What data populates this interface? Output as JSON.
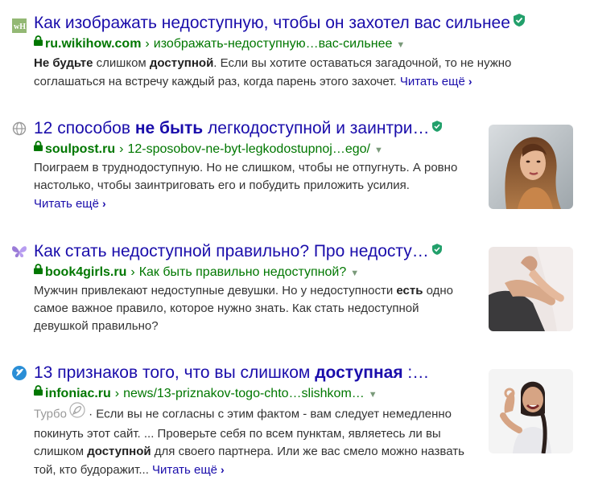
{
  "results": [
    {
      "favicon": "wikihow-logo-icon",
      "favicon_text": "wH",
      "title_parts": [
        {
          "text": "Как изображать недоступную, чтобы он захотел вас сильнее",
          "bold": false
        }
      ],
      "verified": true,
      "domain": "ru.wikihow.com",
      "path": "изображать-недоступную…вас-сильнее",
      "snippet_parts": [
        {
          "text": "Не будьте",
          "bold": true
        },
        {
          "text": " слишком ",
          "bold": false
        },
        {
          "text": "доступной",
          "bold": true
        },
        {
          "text": ". Если вы хотите оставаться загадочной, то не нужно соглашаться на встречу каждый раз, когда парень этого захочет.",
          "bold": false
        }
      ],
      "read_more": "Читать ещё"
    },
    {
      "favicon": "globe-icon",
      "title_parts": [
        {
          "text": "12 способов ",
          "bold": false
        },
        {
          "text": "не быть",
          "bold": true
        },
        {
          "text": " легкодоступной и заинтри…",
          "bold": false
        }
      ],
      "verified": true,
      "domain": "soulpost.ru",
      "path": "12-sposobov-ne-byt-legkodostupnoj…ego/",
      "snippet_parts": [
        {
          "text": "Поиграем в труднодоступную. Но не слишком, чтобы не отпугнуть. А ровно настолько, чтобы заинтриговать его и побудить приложить усилия.",
          "bold": false
        }
      ],
      "read_more": "Читать ещё",
      "thumbnail": "woman-portrait-thumbnail"
    },
    {
      "favicon": "butterfly-icon",
      "title_parts": [
        {
          "text": "Как стать недоступной правильно? Про недосту…",
          "bold": false
        }
      ],
      "verified": true,
      "domain": "book4girls.ru",
      "path": "Как быть правильно недоступной?",
      "snippet_parts": [
        {
          "text": "Мужчин привлекают недоступные девушки. Но у недоступности ",
          "bold": false
        },
        {
          "text": "есть",
          "bold": true
        },
        {
          "text": " одно самое важное правило, которое нужно знать. Как стать недоступной девушкой правильно?",
          "bold": false
        }
      ],
      "thumbnail": "hands-thumbnail"
    },
    {
      "favicon": "infoniac-logo-icon",
      "title_parts": [
        {
          "text": "13 признаков того, что вы слишком ",
          "bold": false
        },
        {
          "text": "доступная",
          "bold": true
        },
        {
          "text": " :…",
          "bold": false
        }
      ],
      "verified": false,
      "domain": "infoniac.ru",
      "path": "news/13-priznakov-togo-chto…slishkom…",
      "turbo_label": "Турбо",
      "snippet_parts": [
        {
          "text": " · Если вы не согласны с этим фактом - вам следует немедленно покинуть этот сайт. ... Проверьте себя по всем пунктам, являетесь ли вы слишком ",
          "bold": false
        },
        {
          "text": "доступной",
          "bold": true
        },
        {
          "text": " для своего партнера. Или же вас смело можно назвать той, кто будоражит...",
          "bold": false
        }
      ],
      "read_more": "Читать ещё",
      "thumbnail": "woman-ok-gesture-thumbnail"
    }
  ],
  "colors": {
    "link": "#1a0dab",
    "url_green": "#007700",
    "verified_green": "#22a06b",
    "snippet": "#333333"
  }
}
